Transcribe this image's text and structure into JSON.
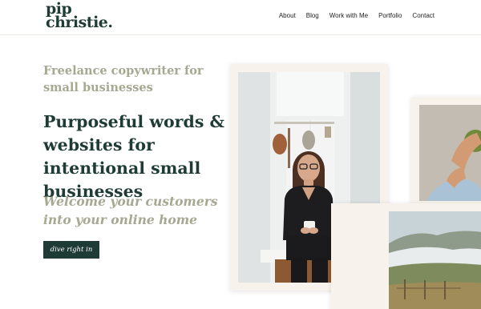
{
  "header": {
    "logo_line1": "pip",
    "logo_line2": "christie.",
    "nav": [
      "About",
      "Blog",
      "Work with Me",
      "Portfolio",
      "Contact"
    ]
  },
  "hero": {
    "eyebrow": "Freelance copywriter for small businesses",
    "headline": "Purposeful words & websites for intentional small businesses",
    "subhead": "Welcome your customers into your online home",
    "cta_label": "dive right in"
  },
  "colors": {
    "brand_green": "#1f3b35",
    "muted_sage": "#a6a892",
    "frame_cream": "#f7f3ec"
  }
}
